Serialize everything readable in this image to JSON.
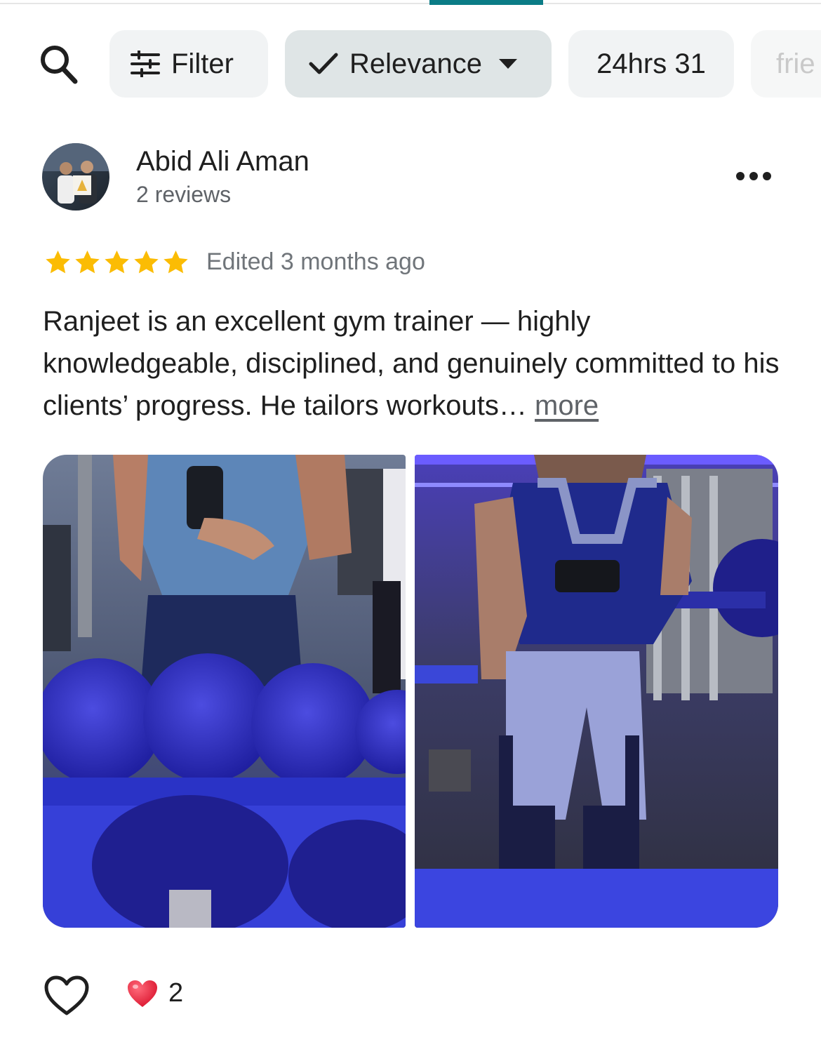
{
  "filters": {
    "search_icon": "search-icon",
    "filter_label": "Filter",
    "filter_icon": "sliders-icon",
    "sort_label": "Relevance",
    "sort_selected_icon": "check-icon",
    "sort_caret_icon": "caret-down-icon",
    "hours_chip": "24hrs 31",
    "friends_chip_partial": "frie"
  },
  "review": {
    "reviewer_name": "Abid Ali Aman",
    "review_count": "2 reviews",
    "rating": 5,
    "rating_max": 5,
    "edited": "Edited 3 months ago",
    "text": "Ranjeet is an excellent gym trainer — highly knowledgeable, disciplined, and genuinely committed to his clients’ progress. He tailors workouts…",
    "more_label": "more",
    "photos": [
      "gym-mirror-selfie-dumbbells",
      "gym-mirror-selfie-full"
    ],
    "reaction_emoji": "heart-emoji",
    "reaction_count": "2"
  },
  "colors": {
    "accent_tab": "#0b7c86",
    "chip_bg": "#f1f3f4",
    "star": "#fbbc04",
    "heart": "#e0245e"
  }
}
